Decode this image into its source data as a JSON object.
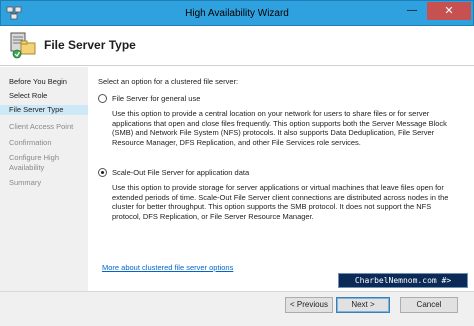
{
  "window": {
    "title": "High Availability Wizard",
    "minimize_glyph": "—",
    "close_glyph": "✕",
    "icon": "cluster-wizard-icon"
  },
  "header": {
    "title": "File Server Type",
    "icon": "file-server-icon"
  },
  "sidebar": {
    "steps": [
      {
        "label": "Before You Begin",
        "state": "done"
      },
      {
        "label": "Select Role",
        "state": "done"
      },
      {
        "label": "File Server Type",
        "state": "active"
      },
      {
        "label": "Client Access Point",
        "state": "pending"
      },
      {
        "label": "Confirmation",
        "state": "pending"
      },
      {
        "label": "Configure High",
        "state": "pending"
      },
      {
        "label": "Availability",
        "state": "pending"
      },
      {
        "label": "Summary",
        "state": "pending"
      }
    ]
  },
  "main": {
    "prompt": "Select an option for a clustered file server:",
    "options": [
      {
        "label": "File Server for general use",
        "selected": false,
        "description_lines": [
          "Use this option to provide a central location on your network for users to share files or for server",
          "applications that open and close files frequently. This option supports both the Server Message Block",
          "(SMB) and Network File System (NFS) protocols. It also supports Data Deduplication, File Server",
          "Resource Manager, DFS Replication, and other File Services role services."
        ]
      },
      {
        "label": "Scale-Out File Server for application data",
        "selected": true,
        "description_lines": [
          "Use this option to provide storage for server applications or virtual machines that leave files open for",
          "extended periods of time. Scale-Out File Server client connections are distributed across nodes in the",
          "cluster for better throughput. This option supports the SMB protocol. It does not support the NFS",
          "protocol, DFS Replication, or File Server Resource Manager."
        ]
      }
    ],
    "link": "More about clustered file server options"
  },
  "watermark": "CharbelNemnom.com #>",
  "footer": {
    "previous": "< Previous",
    "next": "Next >",
    "cancel": "Cancel"
  },
  "colors": {
    "titlebar": "#2fa1df",
    "active_step": "#cde8f7",
    "link": "#0066cc",
    "close_button": "#c75050"
  }
}
